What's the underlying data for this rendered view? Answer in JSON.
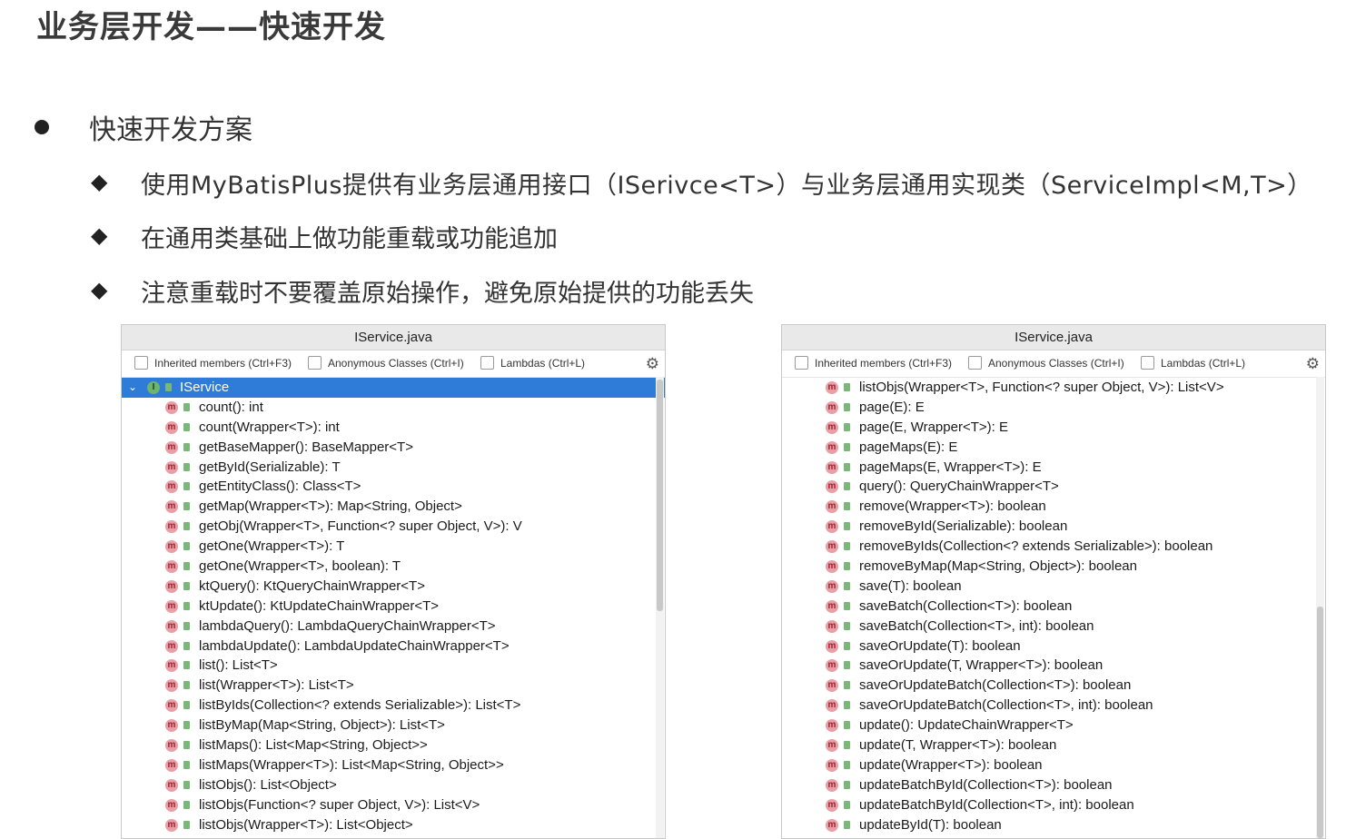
{
  "title": "业务层开发——快速开发",
  "bullet": "快速开发方案",
  "sub_items": [
    "使用MyBatisPlus提供有业务层通用接口（ISerivce<T>）与业务层通用实现类（ServiceImpl<M,T>）",
    "在通用类基础上做功能重载或功能追加",
    "注意重载时不要覆盖原始操作，避免原始提供的功能丢失"
  ],
  "left_panel": {
    "title": "IService.java",
    "options": [
      "Inherited members (Ctrl+F3)",
      "Anonymous Classes (Ctrl+I)",
      "Lambdas (Ctrl+L)"
    ],
    "selected": "IService",
    "methods": [
      "count(): int",
      "count(Wrapper<T>): int",
      "getBaseMapper(): BaseMapper<T>",
      "getById(Serializable): T",
      "getEntityClass(): Class<T>",
      "getMap(Wrapper<T>): Map<String, Object>",
      "getObj(Wrapper<T>, Function<? super Object, V>): V",
      "getOne(Wrapper<T>): T",
      "getOne(Wrapper<T>, boolean): T",
      "ktQuery(): KtQueryChainWrapper<T>",
      "ktUpdate(): KtUpdateChainWrapper<T>",
      "lambdaQuery(): LambdaQueryChainWrapper<T>",
      "lambdaUpdate(): LambdaUpdateChainWrapper<T>",
      "list(): List<T>",
      "list(Wrapper<T>): List<T>",
      "listByIds(Collection<? extends Serializable>): List<T>",
      "listByMap(Map<String, Object>): List<T>",
      "listMaps(): List<Map<String, Object>>",
      "listMaps(Wrapper<T>): List<Map<String, Object>>",
      "listObjs(): List<Object>",
      "listObjs(Function<? super Object, V>): List<V>",
      "listObjs(Wrapper<T>): List<Object>"
    ]
  },
  "right_panel": {
    "title": "IService.java",
    "options": [
      "Inherited members (Ctrl+F3)",
      "Anonymous Classes (Ctrl+I)",
      "Lambdas (Ctrl+L)"
    ],
    "methods": [
      "listObjs(Wrapper<T>, Function<? super Object, V>): List<V>",
      "page(E): E",
      "page(E, Wrapper<T>): E",
      "pageMaps(E): E",
      "pageMaps(E, Wrapper<T>): E",
      "query(): QueryChainWrapper<T>",
      "remove(Wrapper<T>): boolean",
      "removeById(Serializable): boolean",
      "removeByIds(Collection<? extends Serializable>): boolean",
      "removeByMap(Map<String, Object>): boolean",
      "save(T): boolean",
      "saveBatch(Collection<T>): boolean",
      "saveBatch(Collection<T>, int): boolean",
      "saveOrUpdate(T): boolean",
      "saveOrUpdate(T, Wrapper<T>): boolean",
      "saveOrUpdateBatch(Collection<T>): boolean",
      "saveOrUpdateBatch(Collection<T>, int): boolean",
      "update(): UpdateChainWrapper<T>",
      "update(T, Wrapper<T>): boolean",
      "update(Wrapper<T>): boolean",
      "updateBatchById(Collection<T>): boolean",
      "updateBatchById(Collection<T>, int): boolean",
      "updateById(T): boolean"
    ]
  },
  "icons": {
    "method": "method-icon",
    "visibility": "public-lock-icon",
    "settings": "gear-icon",
    "interface": "interface-icon"
  },
  "colors": {
    "selection": "#2f7bd8",
    "method_badge": "#e8a0a6",
    "lock": "#7cb77a"
  }
}
